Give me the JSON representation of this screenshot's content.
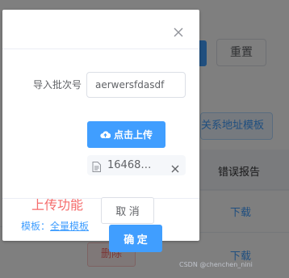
{
  "background": {
    "reset_label": "重置",
    "link_button_label": "关系地址模板",
    "table_header_error": "错误报告",
    "download_label": "下载",
    "delete_label": "删除"
  },
  "dialog": {
    "batch_label": "导入批次号",
    "batch_value": "aerwersfdasdf",
    "upload_label": "点击上传",
    "file_name": "16468…",
    "annotation": "上传功能",
    "template_prefix": "模板：",
    "template_link": "全量模板",
    "cancel_label": "取 消",
    "confirm_label": "确 定"
  },
  "watermark": "CSDN @chenchen_nini",
  "colors": {
    "primary": "#409eff",
    "danger": "#f56c6c",
    "overlay": "rgba(0,0,0,0.5)"
  },
  "icons": {
    "close": "close-icon",
    "upload": "cloud-upload-icon",
    "file": "document-icon",
    "remove": "close-icon"
  }
}
